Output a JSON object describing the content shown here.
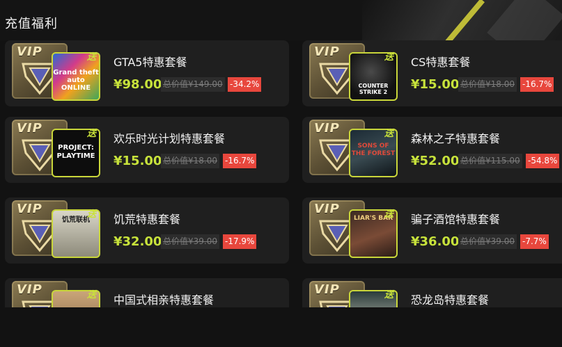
{
  "header": {
    "title": "充值福利"
  },
  "gift_label": "送",
  "vip_label": "VIP",
  "packages": [
    {
      "name": "GTA5特惠套餐",
      "price": "¥98.00",
      "original": "总价值¥149.00",
      "discount": "-34.2%",
      "cover": "gta",
      "cover_text": "Grand theft auto ONLINE"
    },
    {
      "name": "CS特惠套餐",
      "price": "¥15.00",
      "original": "总价值¥18.00",
      "discount": "-16.7%",
      "cover": "cs",
      "cover_text": "COUNTER STRIKE 2"
    },
    {
      "name": "欢乐时光计划特惠套餐",
      "price": "¥15.00",
      "original": "总价值¥18.00",
      "discount": "-16.7%",
      "cover": "pp",
      "cover_text": "PROJECT: PLAYTIME"
    },
    {
      "name": "森林之子特惠套餐",
      "price": "¥52.00",
      "original": "总价值¥115.00",
      "discount": "-54.8%",
      "cover": "forest",
      "cover_text": "SONS OF THE FOREST"
    },
    {
      "name": "饥荒特惠套餐",
      "price": "¥32.00",
      "original": "总价值¥39.00",
      "discount": "-17.9%",
      "cover": "dst",
      "cover_text": "饥荒联机"
    },
    {
      "name": "骗子酒馆特惠套餐",
      "price": "¥36.00",
      "original": "总价值¥39.00",
      "discount": "-7.7%",
      "cover": "liar",
      "cover_text": "LIAR'S BAR"
    },
    {
      "name": "中国式相亲特惠套餐",
      "price": "",
      "original": "",
      "discount": "",
      "cover": "cn",
      "cover_text": ""
    },
    {
      "name": "恐龙岛特惠套餐",
      "price": "",
      "original": "",
      "discount": "",
      "cover": "dino",
      "cover_text": ""
    }
  ]
}
